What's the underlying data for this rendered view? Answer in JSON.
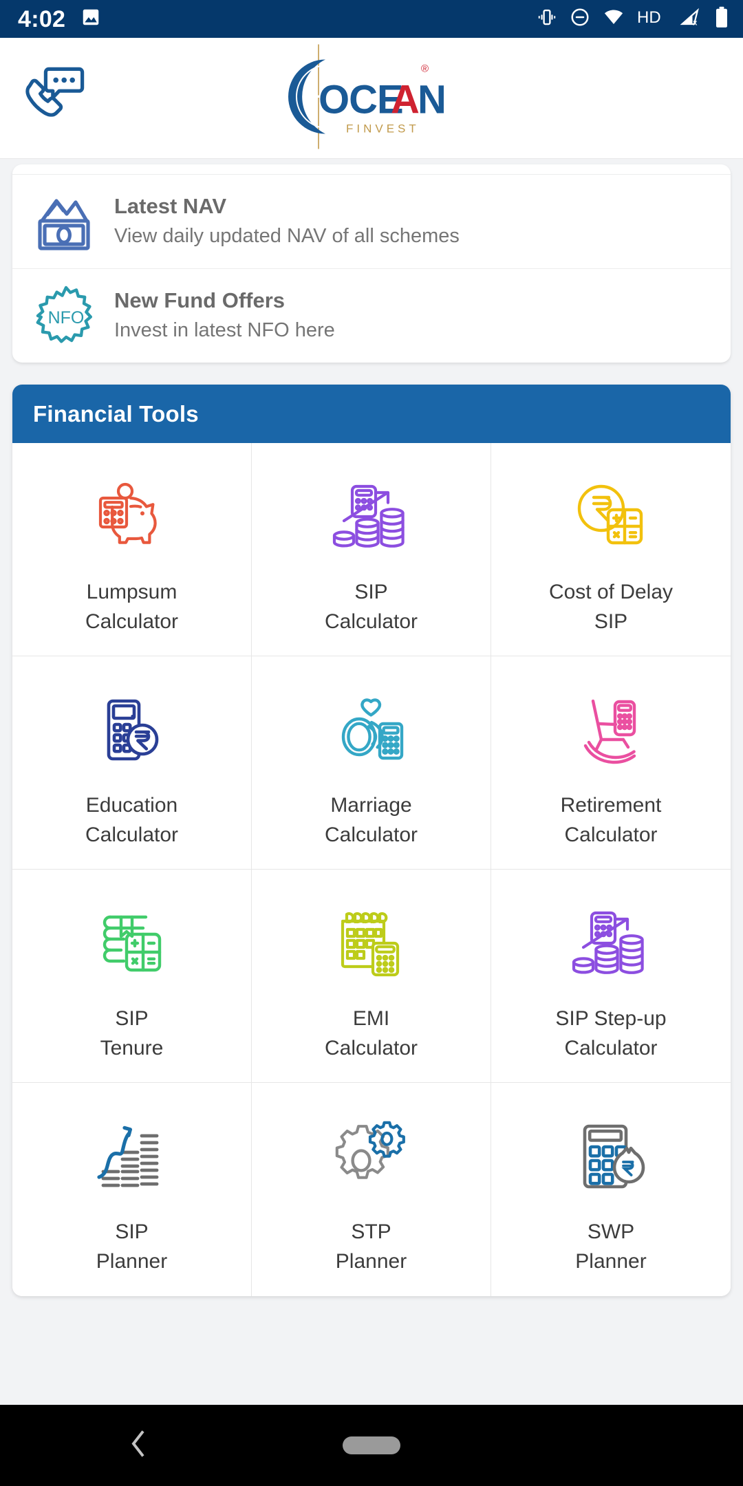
{
  "status_bar": {
    "clock": "4:02",
    "left_icons": [
      "image-icon"
    ],
    "right_icons": [
      "vibrate-icon",
      "do-not-disturb-icon",
      "wifi-icon",
      "hd-icon",
      "cellular-off-icon",
      "battery-icon"
    ],
    "background_color": "#05386b"
  },
  "header": {
    "call_icon": "phone-chat-icon",
    "logo": {
      "brand": "OCEAN",
      "brand_prefix": "OCE",
      "brand_accent": "A",
      "brand_suffix": "N",
      "tagline": "F I N V E S T",
      "trademark": "®",
      "primary_color": "#1a5a96",
      "accent_color": "#cf2230",
      "tagline_color": "#c19a4b"
    }
  },
  "quick_links": [
    {
      "icon": "cash-notes-icon",
      "icon_color": "#4a6fb5",
      "title": "Latest NAV",
      "subtitle": "View daily updated NAV of all schemes"
    },
    {
      "icon": "nfo-badge-icon",
      "icon_color": "#2a9aad",
      "badge_text": "NFO",
      "title": "New Fund Offers",
      "subtitle": "Invest in latest NFO here"
    }
  ],
  "financial_tools": {
    "header_title": "Financial Tools",
    "header_color": "#1a66a8",
    "items": [
      {
        "icon": "piggy-bank-calculator-icon",
        "color": "#e8583d",
        "line1": "Lumpsum",
        "line2": "Calculator"
      },
      {
        "icon": "sip-coins-growth-icon",
        "color": "#8c4ee0",
        "line1": "SIP",
        "line2": "Calculator"
      },
      {
        "icon": "rupee-coin-calculator-icon",
        "color": "#f2c10d",
        "line1": "Cost of Delay",
        "line2": "SIP"
      },
      {
        "icon": "education-calculator-icon",
        "color": "#2a3f96",
        "line1": "Education",
        "line2": "Calculator"
      },
      {
        "icon": "marriage-rings-icon",
        "color": "#34a7c6",
        "line1": "Marriage",
        "line2": "Calculator"
      },
      {
        "icon": "rocking-chair-icon",
        "color": "#ea4fa0",
        "line1": "Retirement",
        "line2": "Calculator"
      },
      {
        "icon": "book-calculator-icon",
        "color": "#41cc6a",
        "line1": "SIP",
        "line2": "Tenure"
      },
      {
        "icon": "calendar-calculator-icon",
        "color": "#bdcc1a",
        "line1": "EMI",
        "line2": "Calculator"
      },
      {
        "icon": "stepup-coins-icon",
        "color": "#8c4ee0",
        "line1": "SIP Step-up",
        "line2": "Calculator"
      },
      {
        "icon": "growth-bars-icon",
        "color": "#1a6fa8",
        "line1": "SIP",
        "line2": "Planner"
      },
      {
        "icon": "gears-icon",
        "color": "#1a6fa8",
        "line1": "STP",
        "line2": "Planner"
      },
      {
        "icon": "calculator-moneybag-icon",
        "color": "#1a6fa8",
        "line1": "SWP",
        "line2": "Planner"
      }
    ]
  },
  "navigation_bar": {
    "back_icon": "back-chevron-icon",
    "home_icon": "home-pill-icon"
  }
}
